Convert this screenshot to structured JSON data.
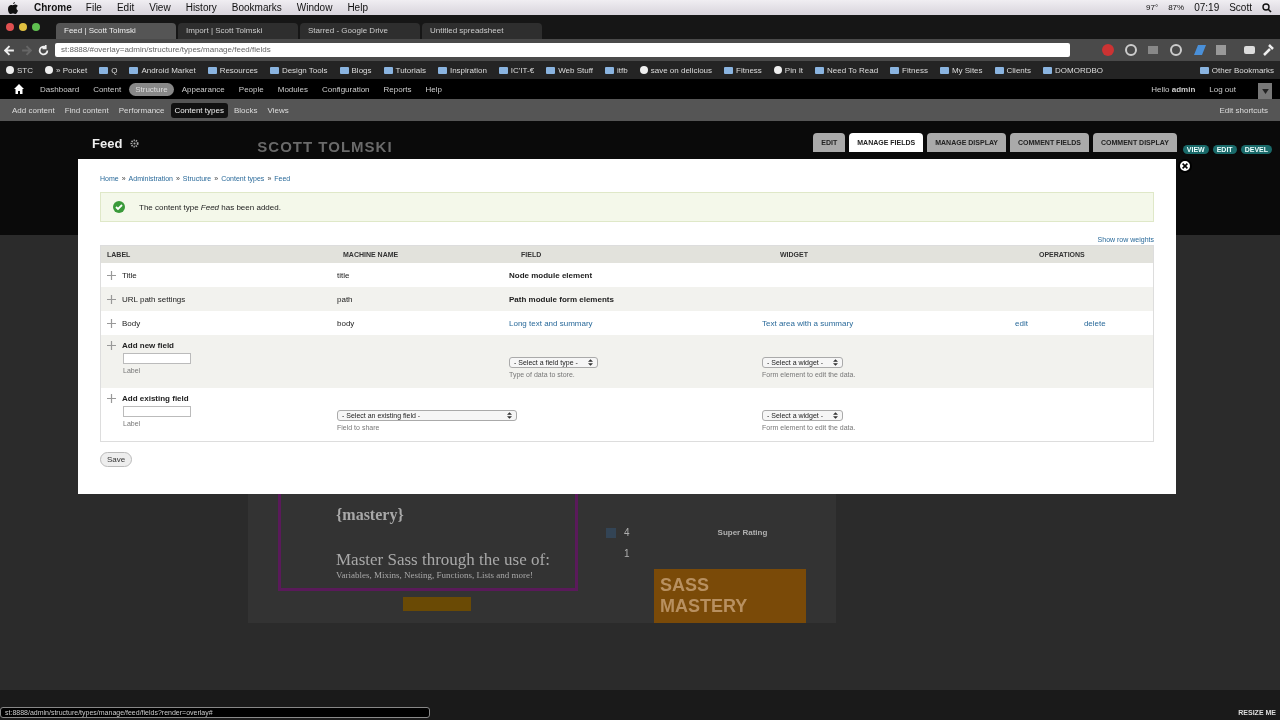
{
  "menubar": {
    "app": "Chrome",
    "items": [
      "File",
      "Edit",
      "View",
      "History",
      "Bookmarks",
      "Window",
      "Help"
    ],
    "temperature": "97°",
    "battery": "87%",
    "time": "07:19",
    "user": "Scott"
  },
  "browser_tabs": [
    {
      "title": "Feed | Scott Tolmski",
      "selected": true
    },
    {
      "title": "Import | Scott Tolmski",
      "selected": false
    },
    {
      "title": "Starred - Google Drive",
      "selected": false
    },
    {
      "title": "Untitled spreadsheet",
      "selected": false
    }
  ],
  "address": "st:8888/#overlay=admin/structure/types/manage/feed/fields",
  "bookmarks": [
    {
      "label": "STC",
      "kind": "page"
    },
    {
      "label": "» Pocket",
      "kind": "page"
    },
    {
      "label": "Q",
      "kind": "folder"
    },
    {
      "label": "Android Market",
      "kind": "folder"
    },
    {
      "label": "Resources",
      "kind": "folder"
    },
    {
      "label": "Design Tools",
      "kind": "folder"
    },
    {
      "label": "Blogs",
      "kind": "folder"
    },
    {
      "label": "Tutorials",
      "kind": "folder"
    },
    {
      "label": "Inspiration",
      "kind": "folder"
    },
    {
      "label": "IC'IT-€",
      "kind": "folder"
    },
    {
      "label": "Web Stuff",
      "kind": "folder"
    },
    {
      "label": "itfb",
      "kind": "folder"
    },
    {
      "label": "save on delicious",
      "kind": "page"
    },
    {
      "label": "Fitness",
      "kind": "folder"
    },
    {
      "label": "Pin It",
      "kind": "page"
    },
    {
      "label": "Need To Read",
      "kind": "folder"
    },
    {
      "label": "Fitness",
      "kind": "folder"
    },
    {
      "label": "My Sites",
      "kind": "folder"
    },
    {
      "label": "Clients",
      "kind": "folder"
    },
    {
      "label": "DOMORDBO",
      "kind": "folder"
    }
  ],
  "other_bookmarks": "Other Bookmarks",
  "admin_toolbar": {
    "items": [
      {
        "label": "Dashboard",
        "selected": false
      },
      {
        "label": "Content",
        "selected": false
      },
      {
        "label": "Structure",
        "selected": true
      },
      {
        "label": "Appearance",
        "selected": false
      },
      {
        "label": "People",
        "selected": false
      },
      {
        "label": "Modules",
        "selected": false
      },
      {
        "label": "Configuration",
        "selected": false
      },
      {
        "label": "Reports",
        "selected": false
      },
      {
        "label": "Help",
        "selected": false
      }
    ],
    "greeting": "Hello",
    "user": "admin",
    "logout": "Log out"
  },
  "shortcuts": {
    "items": [
      {
        "label": "Add content",
        "selected": false
      },
      {
        "label": "Find content",
        "selected": false
      },
      {
        "label": "Performance",
        "selected": false
      },
      {
        "label": "Content types",
        "selected": true
      },
      {
        "label": "Blocks",
        "selected": false
      },
      {
        "label": "Views",
        "selected": false
      }
    ],
    "edit": "Edit shortcuts"
  },
  "page": {
    "title": "Feed",
    "logo": "SCOTT TOLMSKI",
    "tabs": [
      {
        "label": "EDIT",
        "selected": false
      },
      {
        "label": "MANAGE FIELDS",
        "selected": true
      },
      {
        "label": "MANAGE DISPLAY",
        "selected": false
      },
      {
        "label": "COMMENT FIELDS",
        "selected": false
      },
      {
        "label": "COMMENT DISPLAY",
        "selected": false
      }
    ],
    "actions": [
      "VIEW",
      "EDIT",
      "DEVEL"
    ],
    "card": {
      "heading": "{mastery}",
      "subheading": "Master Sass through the use of:",
      "tagline": "Variables, Mixins, Nesting, Functions, Lists and more!",
      "count_1": "4",
      "count_2": "1",
      "rating": "Super Rating",
      "banner": "SASS MASTERY"
    }
  },
  "overlay": {
    "breadcrumb": [
      "Home",
      "Administration",
      "Structure",
      "Content types",
      "Feed"
    ],
    "separator": "»",
    "message": "The content type *Feed* has been added.",
    "show_weights": "Show row weights",
    "columns": [
      "LABEL",
      "MACHINE NAME",
      "FIELD",
      "WIDGET",
      "OPERATIONS"
    ],
    "rows": [
      {
        "label": "Title",
        "machine": "title",
        "field": "Node module element",
        "linked": false
      },
      {
        "label": "URL path settings",
        "machine": "path",
        "field": "Path module form elements",
        "linked": false
      },
      {
        "label": "Body",
        "machine": "body",
        "field": "Long text and summary",
        "widget": "Text area with a summary",
        "edit": "edit",
        "delete": "delete",
        "linked": true
      }
    ],
    "add_new": {
      "title": "Add new field",
      "input_hint": "Label",
      "type_select": "- Select a field type -",
      "type_hint": "Type of data to store.",
      "widget_select": "- Select a widget -",
      "widget_hint": "Form element to edit the data."
    },
    "add_existing": {
      "title": "Add existing field",
      "input_hint": "Label",
      "field_select": "- Select an existing field -",
      "field_hint": "Field to share",
      "widget_select": "- Select a widget -",
      "widget_hint": "Form element to edit the data."
    },
    "save": "Save"
  },
  "status_url": "st:8888/admin/structure/types/manage/feed/fields?render=overlay#",
  "resize": "RESIZE ME"
}
